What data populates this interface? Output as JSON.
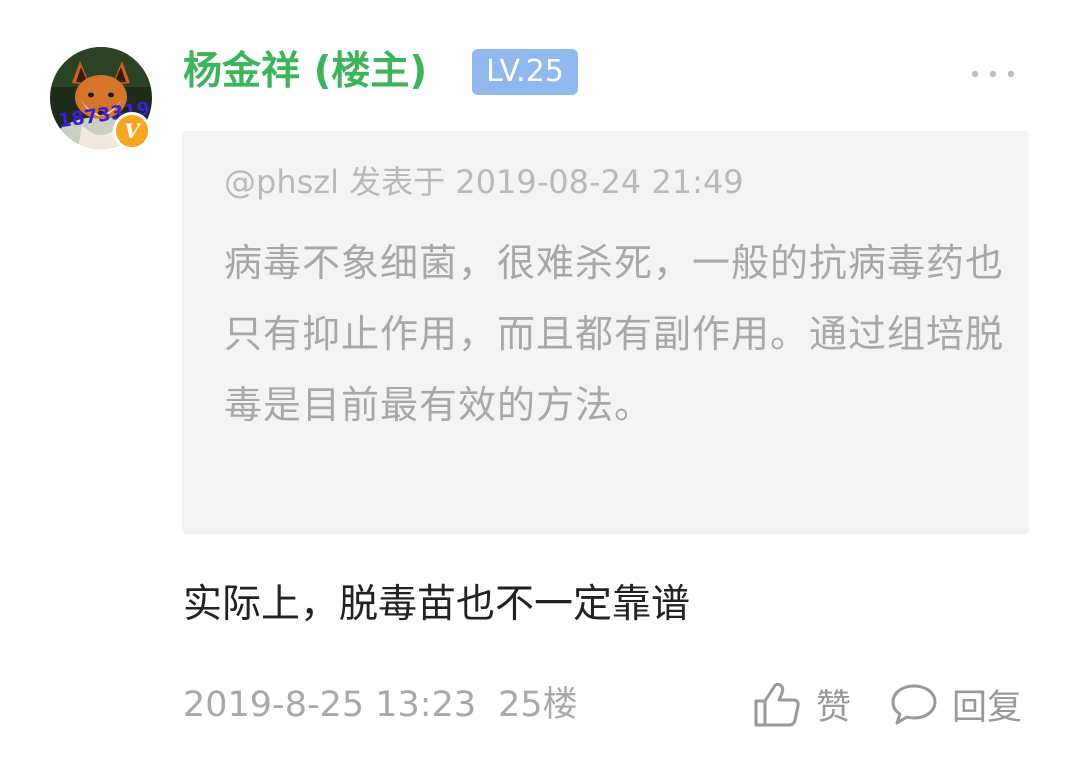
{
  "author": {
    "name": "杨金祥 (楼主)",
    "level": "LV.25",
    "avatar_icon": "fox-avatar-icon",
    "avatar_text": "1873319",
    "badge_text": "V",
    "name_color": "#3cb55a",
    "level_color": "#8fb8ee",
    "badge_color": "#f5a623"
  },
  "quote": {
    "meta": "@phszl 发表于 2019-08-24 21:49",
    "text": "病毒不象细菌，很难杀死，一般的抗病毒药也只有抑止作用，而且都有副作用。通过组培脱毒是目前最有效的方法。"
  },
  "post": {
    "content": "实际上，脱毒苗也不一定靠谱",
    "timestamp": "2019-8-25 13:23",
    "floor": "25楼"
  },
  "actions": {
    "like_label": "赞",
    "reply_label": "回复",
    "more_icon": "more-options-icon"
  }
}
